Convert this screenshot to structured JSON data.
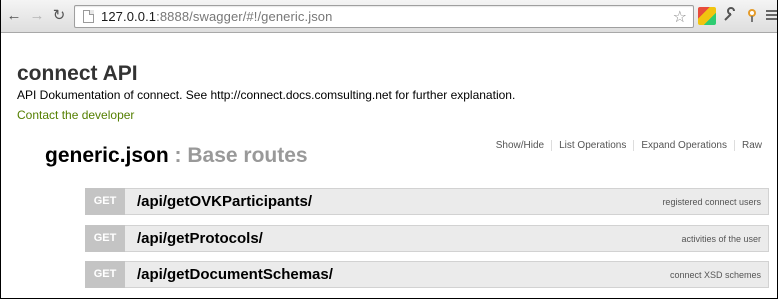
{
  "browser": {
    "url_host": "127.0.0.1",
    "url_rest": ":8888/swagger/#!/generic.json",
    "icons": [
      "back-arrow-icon",
      "forward-arrow-icon",
      "reload-icon",
      "page-icon",
      "bookmark-star-icon",
      "extension-icon",
      "wrench-icon",
      "gear-icon",
      "settings-icon"
    ],
    "back_glyph": "←",
    "fwd_glyph": "→",
    "reload_glyph": "↻",
    "star_glyph": "☆"
  },
  "api": {
    "title": "connect API",
    "description": "API Dokumentation of connect. See http://connect.docs.comsulting.net for further explanation.",
    "contact": "Contact the developer"
  },
  "resource": {
    "name": "generic.json",
    "separator_desc": " : Base routes",
    "operations": [
      "Show/Hide",
      "List Operations",
      "Expand Operations",
      "Raw"
    ]
  },
  "endpoints": [
    {
      "method": "GET",
      "path": "/api/getOVKParticipants/",
      "summary": "registered connect users"
    },
    {
      "method": "GET",
      "path": "/api/getProtocols/",
      "summary": "activities of the user"
    },
    {
      "method": "GET",
      "path": "/api/getDocumentSchemas/",
      "summary": "connect XSD schemes"
    }
  ],
  "colors": {
    "accent_green": "#547f00",
    "method_gray": "#c4c4c4"
  }
}
